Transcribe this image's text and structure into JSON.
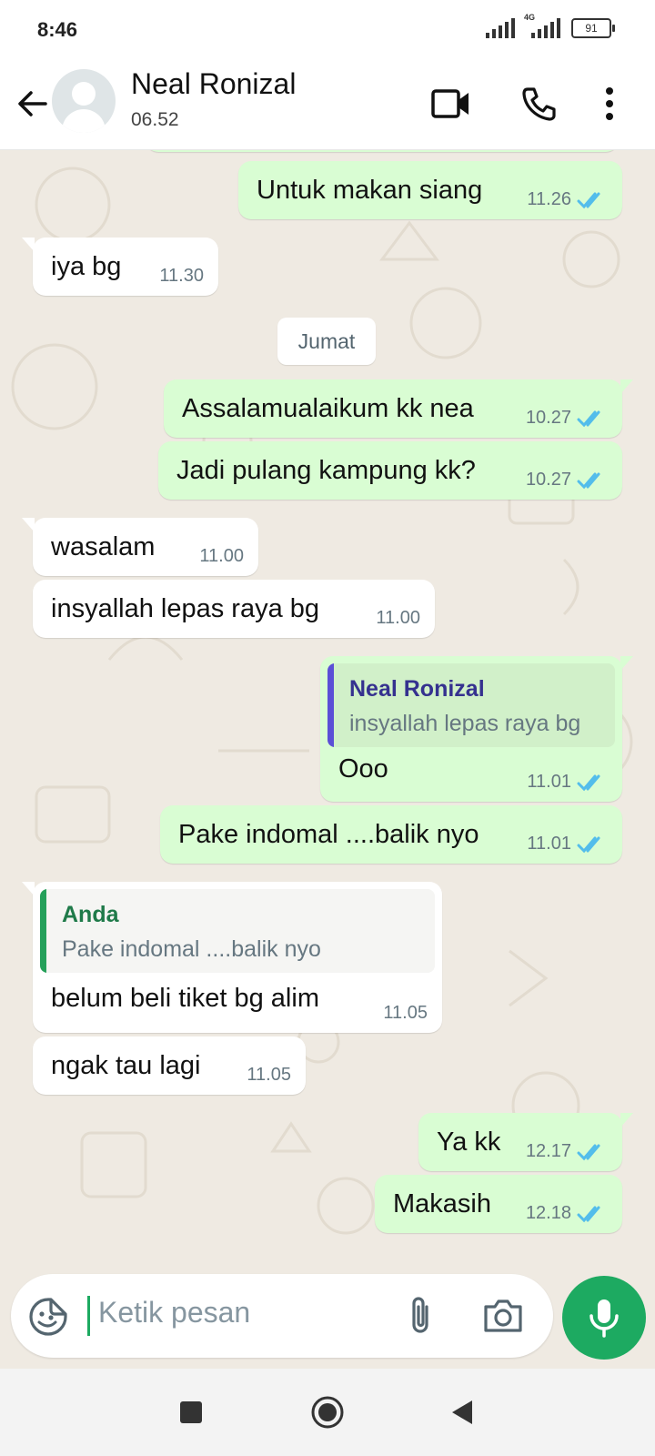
{
  "status": {
    "time": "8:46",
    "network": "4G",
    "battery": "91"
  },
  "header": {
    "name": "Neal Ronizal",
    "subtitle": "06.52"
  },
  "messages": [
    {
      "dir": "out",
      "text": "Untuk makan siang",
      "time": "11.26",
      "status": "read"
    },
    {
      "dir": "in",
      "text": "iya bg",
      "time": "11.30"
    },
    {
      "dir": "date",
      "text": "Jumat"
    },
    {
      "dir": "out",
      "text": "Assalamualaikum kk nea",
      "time": "10.27",
      "status": "read"
    },
    {
      "dir": "out",
      "text": "Jadi pulang kampung kk?",
      "time": "10.27",
      "status": "read"
    },
    {
      "dir": "in",
      "text": "wasalam",
      "time": "11.00"
    },
    {
      "dir": "in",
      "text": "insyallah lepas raya bg",
      "time": "11.00"
    },
    {
      "dir": "out",
      "reply_to": {
        "name": "Neal Ronizal",
        "text": "insyallah lepas raya bg"
      },
      "text": "Ooo",
      "time": "11.01",
      "status": "read"
    },
    {
      "dir": "out",
      "text": "Pake indomal ....balik nyo",
      "time": "11.01",
      "status": "read"
    },
    {
      "dir": "in",
      "reply_to": {
        "name": "Anda",
        "text": "Pake indomal ....balik nyo"
      },
      "text": "belum beli tiket bg alim",
      "time": "11.05"
    },
    {
      "dir": "in",
      "text": "ngak tau lagi",
      "time": "11.05"
    },
    {
      "dir": "out",
      "text": "Ya kk",
      "time": "12.17",
      "status": "read"
    },
    {
      "dir": "out",
      "text": "Makasih",
      "time": "12.18",
      "status": "read"
    }
  ],
  "input": {
    "placeholder": "Ketik pesan"
  },
  "colors": {
    "outgoing_bubble": "#d9fdd3",
    "incoming_bubble": "#ffffff",
    "wallpaper": "#efeae2",
    "read_ticks": "#53bdeb",
    "accent_green": "#1daa61",
    "reply_bar_contact": "#5b4fd6",
    "reply_bar_self": "#25a05a"
  },
  "icons": [
    "back-arrow-icon",
    "video-call-icon",
    "voice-call-icon",
    "more-options-icon",
    "sticker-icon",
    "attach-icon",
    "camera-icon",
    "mic-icon",
    "nav-recents-icon",
    "nav-home-icon",
    "nav-back-icon"
  ]
}
